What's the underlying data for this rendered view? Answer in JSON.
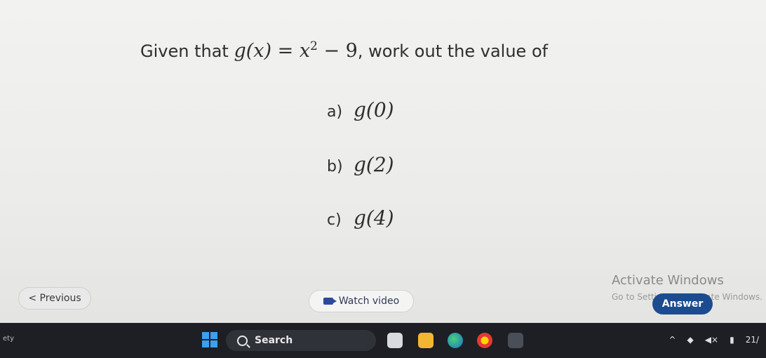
{
  "question": {
    "intro": "Given that",
    "function_lhs": "g(x) = x",
    "exponent": "2",
    "function_rhs": " − 9",
    "outro": ", work out the value of"
  },
  "parts": [
    {
      "label": "a)",
      "expr": "g(0)"
    },
    {
      "label": "b)",
      "expr": "g(2)"
    },
    {
      "label": "c)",
      "expr": "g(4)"
    }
  ],
  "watermark": {
    "title": "Activate Windows",
    "subtitle": "Go to Settings to activate Windows."
  },
  "buttons": {
    "previous": "< Previous",
    "watch_video": "Watch video",
    "answer": "Answer"
  },
  "taskbar": {
    "left_text": "ety",
    "search_label": "Search",
    "clock": "21/"
  },
  "colors": {
    "answer_button": "#1c4b8f",
    "taskbar": "#1d1f24",
    "screen_background": "#f0f0ee"
  }
}
